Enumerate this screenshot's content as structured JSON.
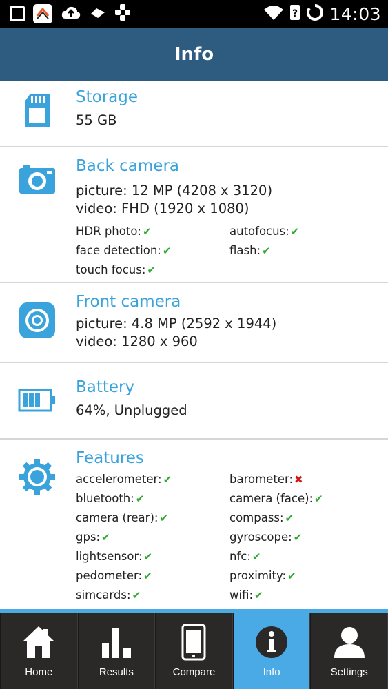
{
  "status_bar": {
    "time": "14:03",
    "icons": [
      "square-icon",
      "app-icon",
      "cloud-upload-icon",
      "pushbullet-icon",
      "puzzle-icon",
      "wifi-icon",
      "sim-unknown-icon",
      "battery-ring-icon"
    ]
  },
  "header": {
    "title": "Info"
  },
  "sections": {
    "storage": {
      "title": "Storage",
      "value": "55 GB",
      "icon": "sd-card-icon"
    },
    "back_camera": {
      "title": "Back camera",
      "picture": "picture: 12 MP (4208 x 3120)",
      "video": "video: FHD (1920 x 1080)",
      "icon": "camera-icon",
      "flags": [
        {
          "label": "HDR photo:",
          "supported": true
        },
        {
          "label": "autofocus:",
          "supported": true
        },
        {
          "label": "face detection:",
          "supported": true
        },
        {
          "label": "flash:",
          "supported": true
        },
        {
          "label": "touch focus:",
          "supported": true
        }
      ]
    },
    "front_camera": {
      "title": "Front camera",
      "picture": "picture: 4.8 MP (2592 x 1944)",
      "video": "video: 1280 x 960",
      "icon": "front-camera-icon"
    },
    "battery": {
      "title": "Battery",
      "value": "64%, Unplugged",
      "icon": "battery-icon"
    },
    "features": {
      "title": "Features",
      "icon": "gear-icon",
      "flags": [
        {
          "label": "accelerometer:",
          "supported": true
        },
        {
          "label": "barometer:",
          "supported": false
        },
        {
          "label": "bluetooth:",
          "supported": true
        },
        {
          "label": "camera (face):",
          "supported": true
        },
        {
          "label": "camera (rear):",
          "supported": true
        },
        {
          "label": "compass:",
          "supported": true
        },
        {
          "label": "gps:",
          "supported": true
        },
        {
          "label": "gyroscope:",
          "supported": true
        },
        {
          "label": "lightsensor:",
          "supported": true
        },
        {
          "label": "nfc:",
          "supported": true
        },
        {
          "label": "pedometer:",
          "supported": true
        },
        {
          "label": "proximity:",
          "supported": true
        },
        {
          "label": "simcards:",
          "supported": true
        },
        {
          "label": "wifi:",
          "supported": true
        }
      ]
    }
  },
  "marks": {
    "yes": "✔",
    "no": "✖"
  },
  "colors": {
    "header": "#2e5c80",
    "accent": "#3ba3dc",
    "nav_bg": "#2b2928",
    "nav_active": "#4aaae6",
    "check": "#2ea82e",
    "cross": "#d01818"
  },
  "nav": {
    "active": "info",
    "items": [
      {
        "id": "home",
        "label": "Home",
        "icon": "home-icon"
      },
      {
        "id": "results",
        "label": "Results",
        "icon": "bar-chart-icon"
      },
      {
        "id": "compare",
        "label": "Compare",
        "icon": "phone-icon"
      },
      {
        "id": "info",
        "label": "Info",
        "icon": "info-icon"
      },
      {
        "id": "settings",
        "label": "Settings",
        "icon": "person-icon"
      }
    ]
  }
}
